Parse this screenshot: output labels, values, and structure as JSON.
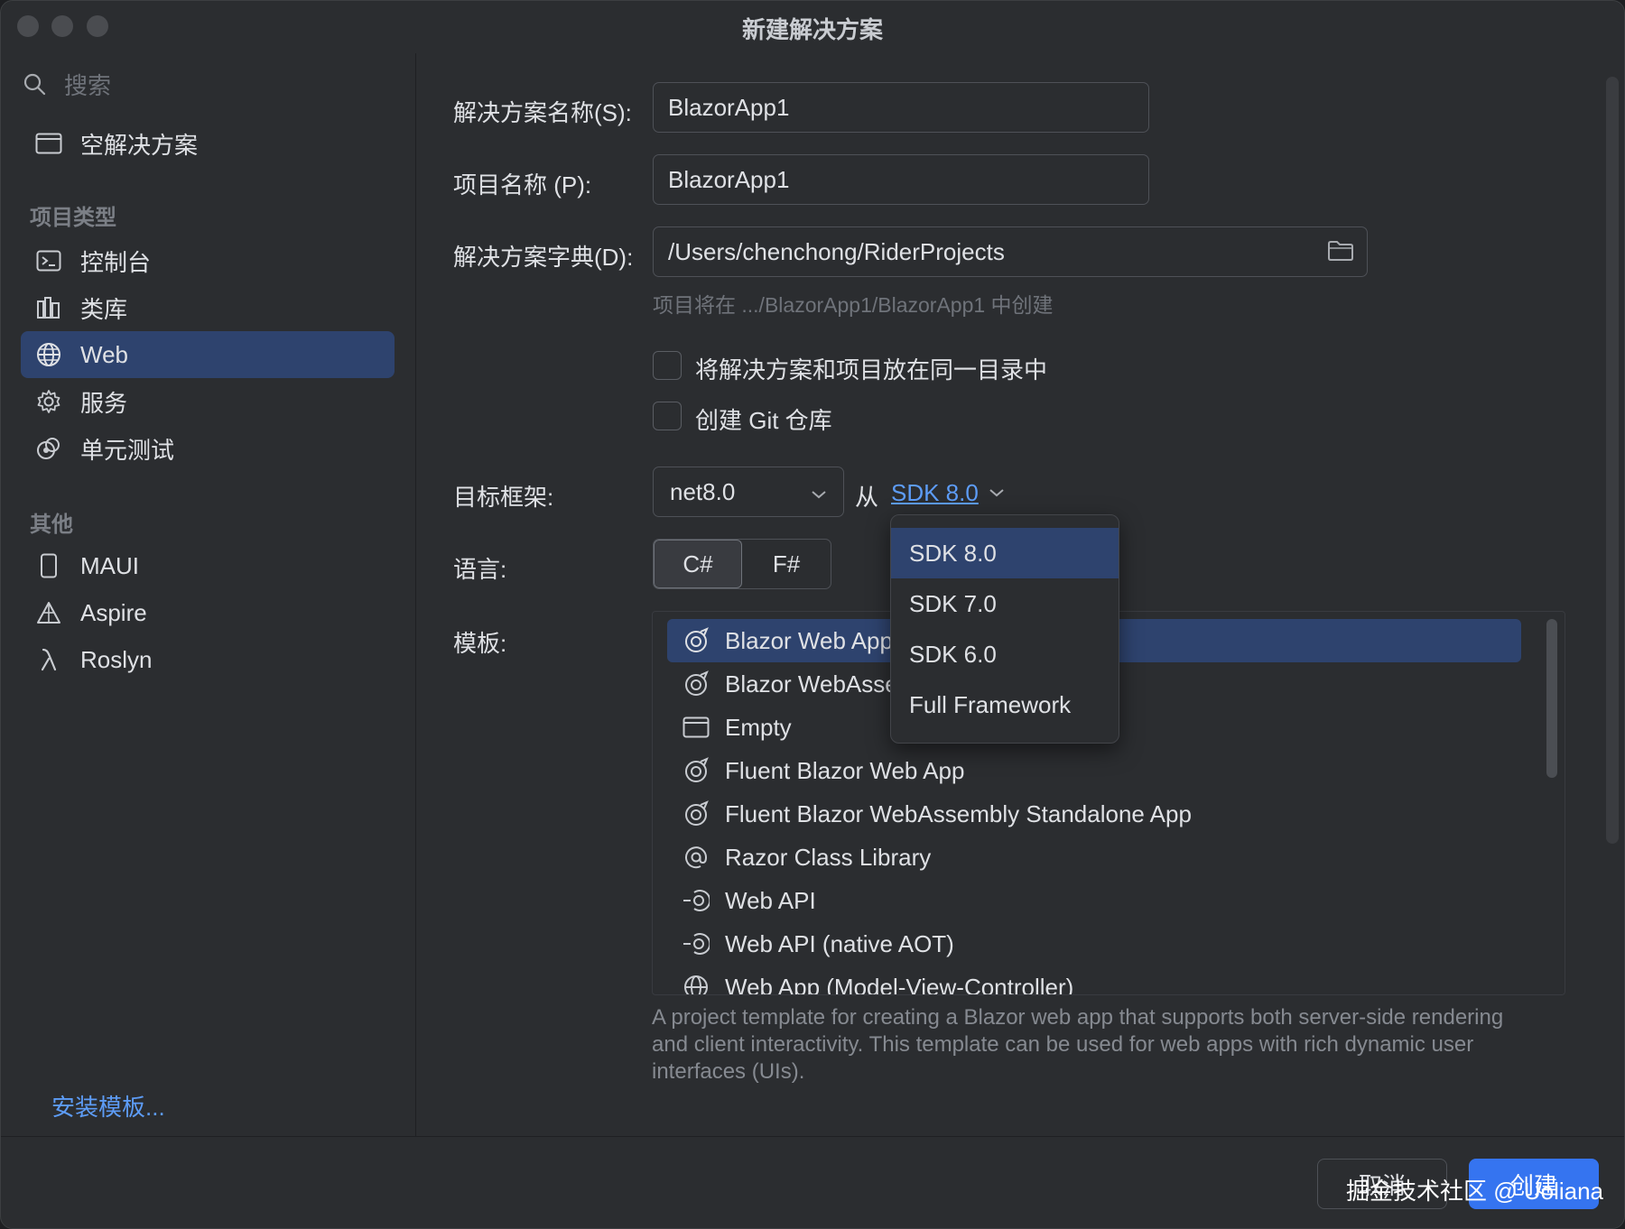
{
  "window": {
    "title": "新建解决方案"
  },
  "sidebar": {
    "search_placeholder": "搜索",
    "top_item": "空解决方案",
    "section_project_types": "项目类型",
    "project_types": [
      {
        "label": "控制台",
        "icon": "console-icon"
      },
      {
        "label": "类库",
        "icon": "library-icon"
      },
      {
        "label": "Web",
        "icon": "globe-icon",
        "selected": true
      },
      {
        "label": "服务",
        "icon": "gear-icon"
      },
      {
        "label": "单元测试",
        "icon": "unit-test-icon"
      }
    ],
    "section_other": "其他",
    "other": [
      {
        "label": "MAUI",
        "icon": "phone-icon"
      },
      {
        "label": "Aspire",
        "icon": "aspire-icon"
      },
      {
        "label": "Roslyn",
        "icon": "lambda-icon"
      }
    ],
    "install_link": "安装模板..."
  },
  "form": {
    "solution_name_label": "解决方案名称(S):",
    "solution_name": "BlazorApp1",
    "project_name_label": "项目名称 (P):",
    "project_name": "BlazorApp1",
    "solution_dir_label": "解决方案字典(D):",
    "solution_dir": "/Users/chenchong/RiderProjects",
    "dir_hint": "项目将在 .../BlazorApp1/BlazorApp1 中创建",
    "same_dir_label": "将解决方案和项目放在同一目录中",
    "same_dir_checked": false,
    "git_label": "创建 Git 仓库",
    "git_checked": false,
    "framework_label": "目标框架:",
    "framework_value": "net8.0",
    "from_text": "从",
    "sdk_link": "SDK 8.0",
    "language_label": "语言:",
    "languages": [
      "C#",
      "F#"
    ],
    "language_selected": "C#",
    "template_label": "模板:"
  },
  "templates": [
    {
      "label": "Blazor Web App",
      "icon": "blazor-icon",
      "selected": true
    },
    {
      "label": "Blazor WebAssembly Standalone App",
      "icon": "blazor-icon"
    },
    {
      "label": "Empty",
      "icon": "window-icon"
    },
    {
      "label": "Fluent Blazor Web App",
      "icon": "blazor-icon"
    },
    {
      "label": "Fluent Blazor WebAssembly Standalone App",
      "icon": "blazor-icon"
    },
    {
      "label": "Razor Class Library",
      "icon": "at-icon"
    },
    {
      "label": "Web API",
      "icon": "api-icon"
    },
    {
      "label": "Web API (native AOT)",
      "icon": "api-icon"
    },
    {
      "label": "Web App (Model-View-Controller)",
      "icon": "globe-icon"
    }
  ],
  "template_description": "A project template for creating a Blazor web app that supports both server-side rendering and client interactivity. This template can be used for web apps with rich dynamic user interfaces (UIs).",
  "sdk_dropdown": {
    "options": [
      "SDK 8.0",
      "SDK 7.0",
      "SDK 6.0",
      "Full Framework"
    ],
    "selected": "SDK 8.0"
  },
  "footer": {
    "cancel": "取消",
    "create": "创建",
    "watermark": "掘金技术社区 @ Uoliana"
  },
  "colors": {
    "accent": "#3574f0",
    "selection": "#2e436e",
    "link": "#5d9cf6",
    "background": "#2b2d30"
  }
}
